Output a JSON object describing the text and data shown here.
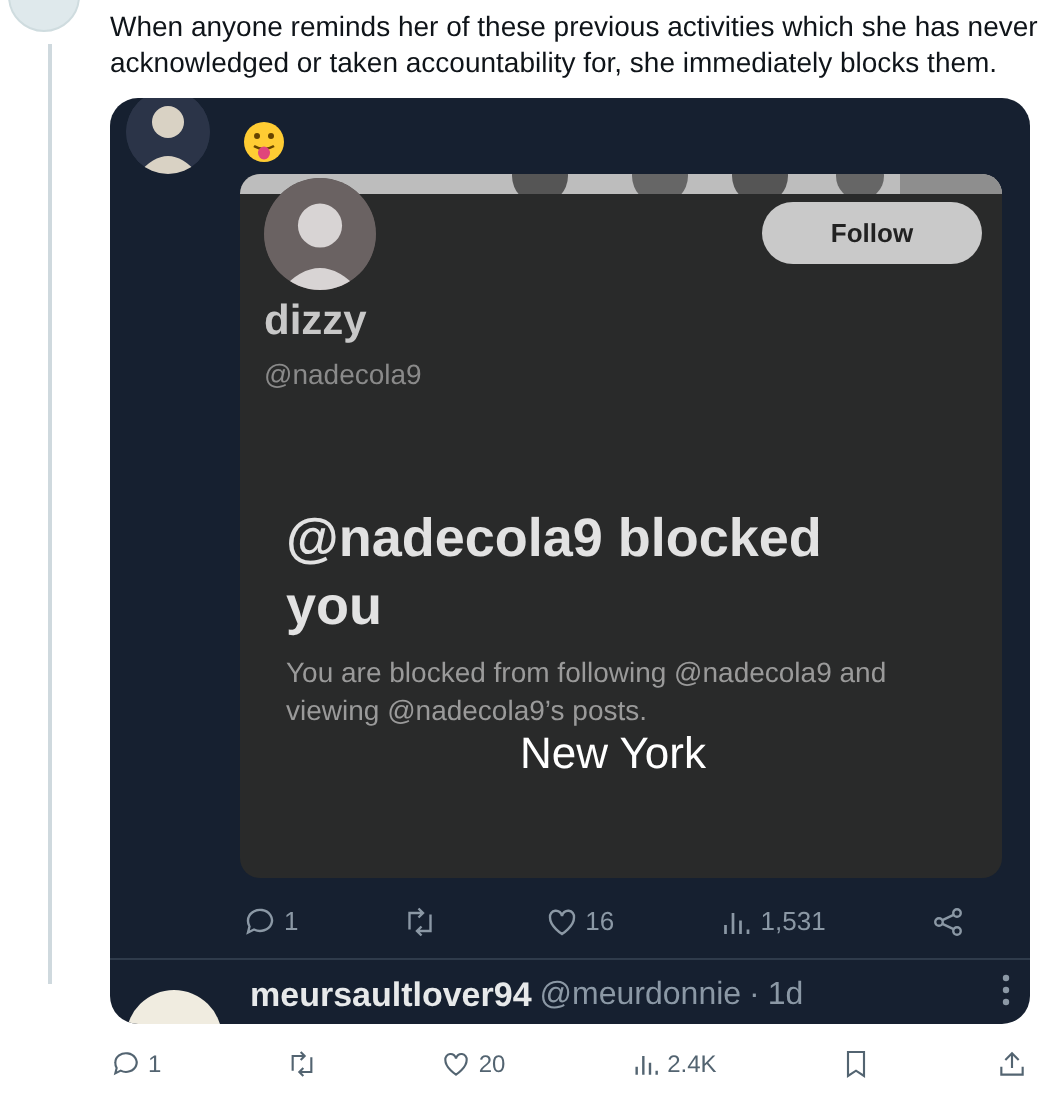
{
  "tweet": {
    "text": "When anyone reminds her of these previous activities which she has never acknowledged or taken accountability for, she immediately blocks them."
  },
  "embedded_post": {
    "screenshot": {
      "profile_name": "dizzy",
      "handle": "@nadecola9",
      "follow_button": "Follow",
      "blocked_title": "@nadecola9 blocked you",
      "blocked_message": "You are blocked from following @nadecola9 and viewing @nadecola9’s posts.",
      "caption": "New York"
    },
    "actions": [
      {
        "kind": "reply",
        "count": "1"
      },
      {
        "kind": "repost"
      },
      {
        "kind": "like",
        "count": "16"
      },
      {
        "kind": "views",
        "count": "1,531"
      },
      {
        "kind": "share"
      }
    ]
  },
  "quoted_reply": {
    "name": "meursaultlover94",
    "handle": "@meurdonnie",
    "separator": "·",
    "time": "1d"
  },
  "actions": [
    {
      "kind": "reply",
      "count": "1"
    },
    {
      "kind": "repost"
    },
    {
      "kind": "like",
      "count": "20"
    },
    {
      "kind": "views",
      "count": "2.4K"
    },
    {
      "kind": "bookmark"
    },
    {
      "kind": "share-up"
    }
  ]
}
